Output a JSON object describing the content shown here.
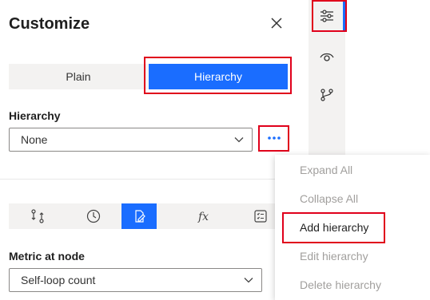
{
  "panel": {
    "title": "Customize",
    "close_icon": "close-icon"
  },
  "layout_toggle": {
    "options": [
      "Plain",
      "Hierarchy"
    ],
    "selected": "Hierarchy"
  },
  "hierarchy": {
    "label": "Hierarchy",
    "value": "None"
  },
  "tabs": [
    {
      "icon": "process-swap-icon",
      "active": false
    },
    {
      "icon": "clock-icon",
      "active": false
    },
    {
      "icon": "edit-document-icon",
      "active": true
    },
    {
      "icon": "function-fx-icon",
      "active": false
    },
    {
      "icon": "checklist-icon",
      "active": false
    }
  ],
  "metric": {
    "label": "Metric at node",
    "value": "Self-loop count"
  },
  "side_rail": [
    {
      "icon": "sliders-icon",
      "active": true
    },
    {
      "icon": "eye-icon",
      "active": false
    },
    {
      "icon": "branch-icon",
      "active": false
    }
  ],
  "context_menu": {
    "items": [
      "Expand All",
      "Collapse All",
      "Add hierarchy",
      "Edit hierarchy",
      "Delete hierarchy"
    ],
    "enabled": [
      "Add hierarchy"
    ]
  },
  "colors": {
    "accent": "#1a6dff",
    "highlight": "#e0001b",
    "panel_bg": "#ffffff",
    "rail_bg": "#f3f2f1",
    "disabled_text": "#a19f9d"
  }
}
